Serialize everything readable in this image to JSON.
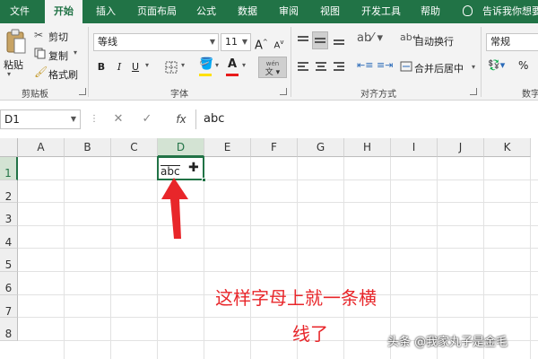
{
  "tabs": [
    "文件",
    "开始",
    "插入",
    "页面布局",
    "公式",
    "数据",
    "审阅",
    "视图",
    "开发工具",
    "帮助"
  ],
  "tell_me": "告诉我你想要",
  "clipboard": {
    "paste": "粘贴",
    "cut": "剪切",
    "copy": "复制",
    "format_painter": "格式刷",
    "title": "剪贴板"
  },
  "font": {
    "name": "等线",
    "size": "11",
    "bold": "B",
    "italic": "I",
    "underline": "U",
    "grow": "A",
    "shrink": "A",
    "phonetic": "wén",
    "title": "字体",
    "font_color": "#e81a1a",
    "fill_color": "#ffe000"
  },
  "alignment": {
    "wrap_text": "自动换行",
    "merge_center": "合并后居中",
    "title": "对齐方式"
  },
  "number": {
    "format": "常规",
    "percent": "%",
    "title": "数字"
  },
  "formula_bar": {
    "name_box": "D1",
    "fx": "fx",
    "content": "abc"
  },
  "columns": [
    "A",
    "B",
    "C",
    "D",
    "E",
    "F",
    "G",
    "H",
    "I",
    "J",
    "K"
  ],
  "rows": [
    "1",
    "2",
    "3",
    "4",
    "5",
    "6",
    "7",
    "8"
  ],
  "cell_d1": "abc",
  "annotation": {
    "line1": "这样字母上就一条横",
    "line2": "线了"
  },
  "watermark": "头条 @我家丸子是金毛",
  "colors": {
    "excel_green": "#217346",
    "annotation_red": "#e8262a"
  }
}
